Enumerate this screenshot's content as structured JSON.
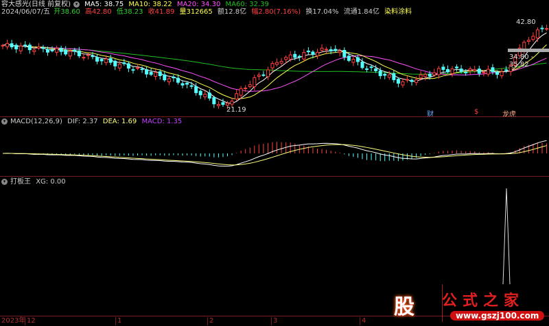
{
  "header": {
    "stock": "容大感光(日线 前复权)",
    "ma5": "MA5: 38.75",
    "ma10": "MA10: 38.22",
    "ma20": "MA20: 34.30",
    "ma60": "MA60: 32.39",
    "date": "2024/06/07/五",
    "open": "开38.60",
    "high": "高42.80",
    "low": "低38.23",
    "close": "收41.89",
    "volume": "量312665",
    "amount": "额12.8亿",
    "change": "幅2.80(7.16%)",
    "turnover": "换17.04%",
    "float": "流通1.84亿",
    "sector": "染料涂料"
  },
  "annotations": {
    "high": "42.80",
    "low": "21.19",
    "range": "34.80 - 35.82",
    "event1": "财",
    "event2": "$",
    "event3": "龙虎"
  },
  "macd": {
    "title": "MACD(12,26,9)",
    "dif": "DIF: 2.37",
    "dea": "DEA: 1.69",
    "macd": "MACD: 1.35"
  },
  "indicator": {
    "name": "打板王",
    "xg": "XG: 0.00"
  },
  "axis": {
    "year": "2023年",
    "months": [
      "12",
      "1",
      "2",
      "3",
      "4"
    ]
  },
  "watermark": {
    "brand": "股",
    "name": "公式之家",
    "url": "www.gszj100.com"
  },
  "colors": {
    "up": "#ff4040",
    "down": "#54ffff",
    "ma5": "#ffffff",
    "ma10": "#ffff50",
    "ma20": "#ff50ff",
    "ma60": "#20c020"
  },
  "chart_data": {
    "type": "candlestick",
    "price_path": [
      [
        0,
        37.1
      ],
      [
        15,
        35.4
      ],
      [
        30,
        31.1
      ],
      [
        40,
        27.7
      ],
      [
        49,
        21.7
      ],
      [
        54,
        26.8
      ],
      [
        62,
        33.7
      ],
      [
        73,
        36.3
      ],
      [
        80,
        32
      ],
      [
        89,
        27.7
      ],
      [
        98,
        31.1
      ],
      [
        112,
        30.3
      ],
      [
        114,
        34.6
      ],
      [
        117,
        38.9
      ],
      [
        121,
        41.9
      ]
    ],
    "ylim": [
      20,
      44
    ]
  }
}
